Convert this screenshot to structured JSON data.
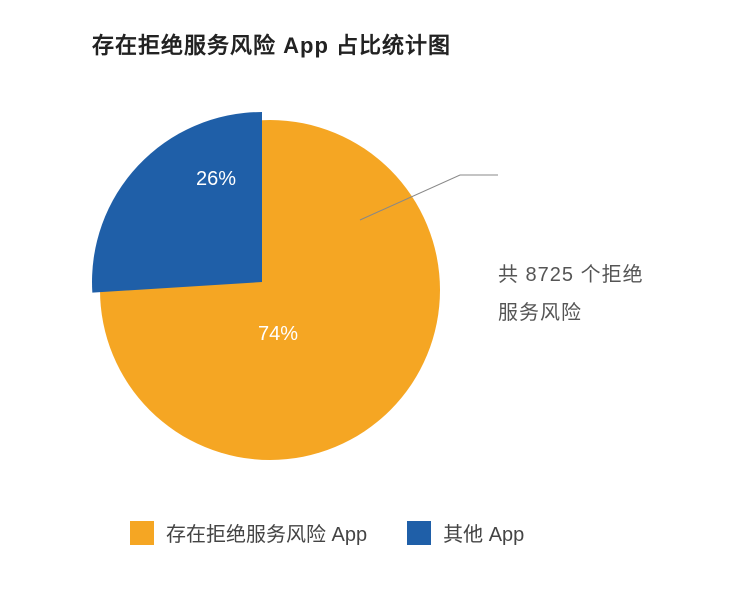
{
  "chart_data": {
    "type": "pie",
    "title": "存在拒绝服务风险 App 占比统计图",
    "series": [
      {
        "name": "存在拒绝服务风险 App",
        "value": 74,
        "label": "74%",
        "color": "#f5a623"
      },
      {
        "name": "其他 App",
        "value": 26,
        "label": "26%",
        "color": "#1f5fa8"
      }
    ],
    "annotation": {
      "line1": "共 8725 个拒绝",
      "line2": "服务风险"
    },
    "legend": [
      {
        "color": "#f5a623",
        "label": "存在拒绝服务风险 App"
      },
      {
        "color": "#1f5fa8",
        "label": "其他 App"
      }
    ]
  }
}
